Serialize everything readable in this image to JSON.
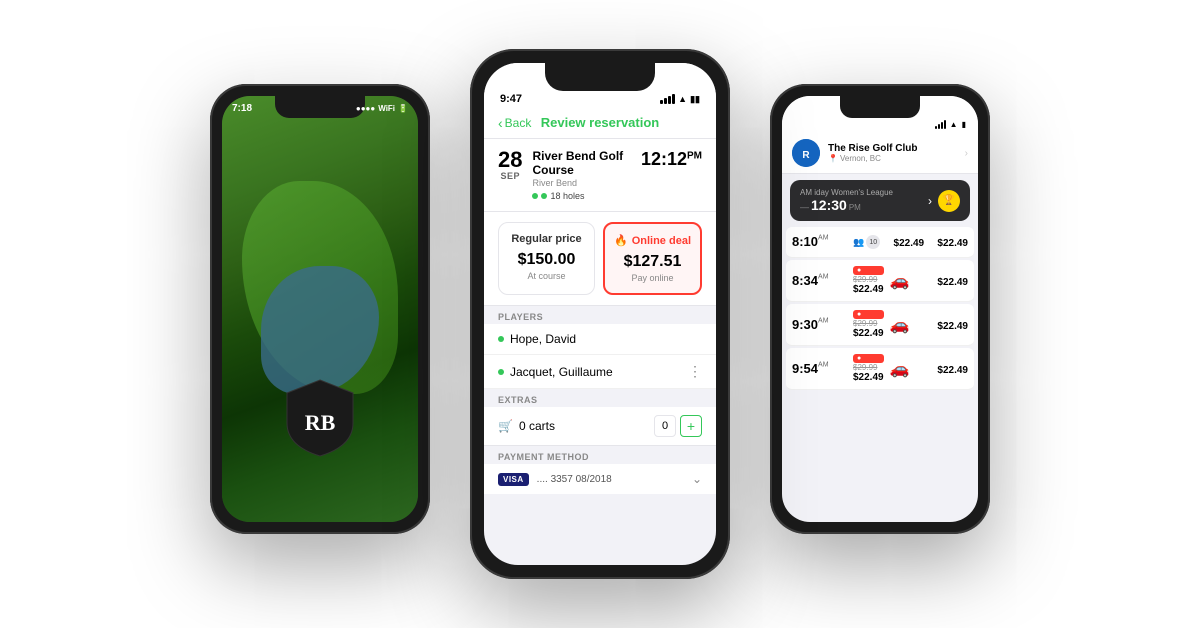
{
  "leftPhone": {
    "statusTime": "7:18",
    "logoLetters": "RB"
  },
  "centerPhone": {
    "statusTime": "9:47",
    "navBack": "Back",
    "navTitle": "Review reservation",
    "date": {
      "day": "28",
      "month": "SEP"
    },
    "courseName": "River Bend Golf Course",
    "courseLocation": "River Bend",
    "holes": "18 holes",
    "teeTime": "12:12",
    "teeTimePeriod": "PM",
    "pricing": {
      "regular": {
        "label": "Regular price",
        "amount": "$150.00",
        "sub": "At course"
      },
      "online": {
        "label": "Online deal",
        "amount": "$127.51",
        "sub": "Pay online"
      }
    },
    "playersLabel": "PLAYERS",
    "players": [
      {
        "name": "Hope, David",
        "hasMenu": false
      },
      {
        "name": "Jacquet, Guillaume",
        "hasMenu": true
      }
    ],
    "extrasLabel": "EXTRAS",
    "extras": {
      "carts": "0 carts"
    },
    "paymentLabel": "PAYMENT METHOD",
    "payment": {
      "brand": "VISA",
      "last4": ".... 3357",
      "expiry": "08/2018"
    }
  },
  "rightPhone": {
    "clubName": "The Rise Golf Club",
    "location": "Vernon, BC",
    "featuredSlot": {
      "label": "iday Women's League",
      "timeSuffix": "AM",
      "time": "12:30",
      "timePeriod": "PM"
    },
    "slots": [
      {
        "time": "8:10",
        "period": "AM",
        "playerCount": "10",
        "priceNormal": "$22.49",
        "priceDeal": "$22.49",
        "hasDeal": false
      },
      {
        "time": "8:34",
        "period": "AM",
        "playerCount": "",
        "priceStrike": "$29.99",
        "priceDeal": "$22.49",
        "hasDeal": true
      },
      {
        "time": "9:30",
        "period": "AM",
        "playerCount": "",
        "priceStrike": "$29.99",
        "priceDeal": "$22.49",
        "hasDeal": true
      },
      {
        "time": "9:54",
        "period": "AM",
        "playerCount": "",
        "priceStrike": "$29.99",
        "priceDeal": "$22.49",
        "hasDeal": true
      }
    ]
  }
}
